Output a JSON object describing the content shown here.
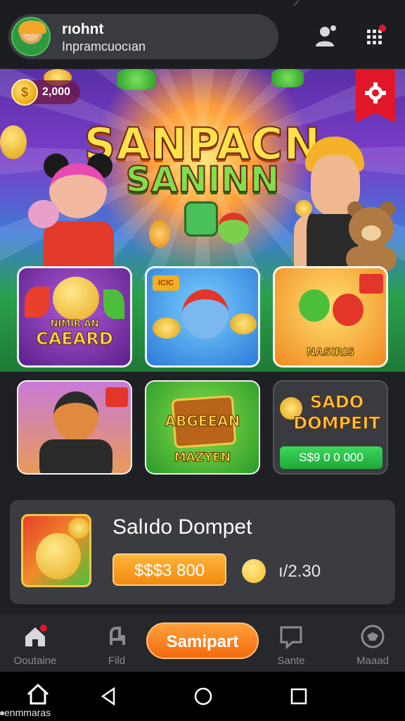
{
  "profile": {
    "name": "rıohnt",
    "subtitle": "Inpramcuocıan"
  },
  "banner": {
    "coin_count": "2,000",
    "title_line1": "SANPACN",
    "title_line2": "SANINN"
  },
  "tiles": [
    {
      "label": "CAEARD",
      "sublabel": "NIMIR AN",
      "icon": "bear-icon"
    },
    {
      "label": "",
      "badge": "ICIC",
      "icon": "cartoon-character-icon"
    },
    {
      "label": "NASIRIS",
      "badge": "",
      "icon": "critters-icon"
    },
    {
      "label": "",
      "badge": "",
      "icon": "cat-man-icon"
    },
    {
      "label": "MAZYEN",
      "sublabel": "ABGEEAN",
      "icon": "treasure-icon"
    },
    {
      "label": "SADO DOMPEIT",
      "amount": "S$9 0 0 000",
      "icon": "coin-icon"
    }
  ],
  "wallet": {
    "title": "Salıdo Dompet",
    "balance": "$$$3 800",
    "ratio": "ı/2.30"
  },
  "bottom_nav": {
    "items": [
      {
        "label": "Ooutaine",
        "icon": "home-icon"
      },
      {
        "label": "Fild",
        "icon": "chair-icon"
      },
      {
        "label": "Sante",
        "icon": "chat-icon"
      },
      {
        "label": "Maaad",
        "icon": "ball-icon"
      }
    ],
    "play_label": "Samipart"
  },
  "system_nav": {
    "label": "enmmaras"
  },
  "colors": {
    "accent_orange": "#f28a10",
    "accent_green": "#27c23e",
    "flag_red": "#e2162b",
    "background": "#1f2024"
  }
}
